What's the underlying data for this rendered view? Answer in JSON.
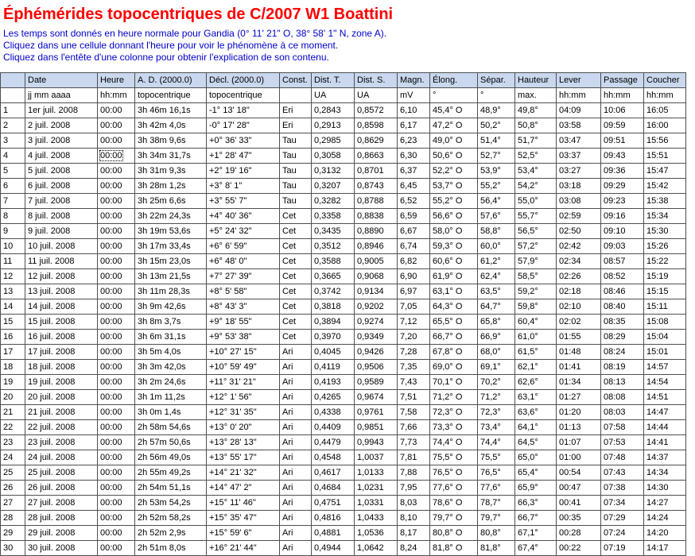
{
  "title": "Éphémérides topocentriques de C/2007 W1 Boattini",
  "intro": [
    "Les temps sont donnés en heure normale pour Gandia (0° 11' 21\" O, 38° 58' 1\" N, zone A).",
    "Cliquez dans une cellule donnant l'heure pour voir le phénomène à ce moment.",
    "Cliquez dans l'entête d'une colonne pour obtenir l'explication de son contenu."
  ],
  "columns": [
    {
      "label": "",
      "unit": ""
    },
    {
      "label": "Date",
      "unit": "jj  mm  aaaa"
    },
    {
      "label": "Heure",
      "unit": "hh:mm"
    },
    {
      "label": "A. D. (2000.0)",
      "unit": "topocentrique"
    },
    {
      "label": "Décl. (2000.0)",
      "unit": "topocentrique"
    },
    {
      "label": "Const.",
      "unit": ""
    },
    {
      "label": "Dist. T.",
      "unit": "UA"
    },
    {
      "label": "Dist. S.",
      "unit": "UA"
    },
    {
      "label": "Magn.",
      "unit": "mV"
    },
    {
      "label": "Élong.",
      "unit": "°"
    },
    {
      "label": "Sépar.",
      "unit": "°"
    },
    {
      "label": "Hauteur",
      "unit": "max."
    },
    {
      "label": "Lever",
      "unit": "hh:mm"
    },
    {
      "label": "Passage",
      "unit": "hh:mm"
    },
    {
      "label": "Coucher",
      "unit": "hh:mm"
    }
  ],
  "selected_cell": {
    "row": 3,
    "col": 2
  },
  "rows": [
    [
      "1",
      "1er juil. 2008",
      "00:00",
      "3h 46m 16,1s",
      "-1° 13' 18\"",
      "Eri",
      "0,2843",
      "0,8572",
      "6,10",
      "45,4° O",
      "48,9°",
      "49,8°",
      "04:09",
      "10:06",
      "16:05"
    ],
    [
      "2",
      "2 juil. 2008",
      "00:00",
      "3h 42m 4,0s",
      "-0° 17' 28\"",
      "Eri",
      "0,2913",
      "0,8598",
      "6,17",
      "47,2° O",
      "50,2°",
      "50,8°",
      "03:58",
      "09:59",
      "16:00"
    ],
    [
      "3",
      "3 juil. 2008",
      "00:00",
      "3h 38m 9,6s",
      "+0° 36' 33\"",
      "Tau",
      "0,2985",
      "0,8629",
      "6,23",
      "49,0° O",
      "51,4°",
      "51,7°",
      "03:47",
      "09:51",
      "15:56"
    ],
    [
      "4",
      "4 juil. 2008",
      "00:00",
      "3h 34m 31,7s",
      "+1° 28' 47\"",
      "Tau",
      "0,3058",
      "0,8663",
      "6,30",
      "50,6° O",
      "52,7°",
      "52,5°",
      "03:37",
      "09:43",
      "15:51"
    ],
    [
      "5",
      "5 juil. 2008",
      "00:00",
      "3h 31m 9,3s",
      "+2° 19' 16\"",
      "Tau",
      "0,3132",
      "0,8701",
      "6,37",
      "52,2° O",
      "53,9°",
      "53,4°",
      "03:27",
      "09:36",
      "15:47"
    ],
    [
      "6",
      "6 juil. 2008",
      "00:00",
      "3h 28m 1,2s",
      "+3° 8' 1\"",
      "Tau",
      "0,3207",
      "0,8743",
      "6,45",
      "53,7° O",
      "55,2°",
      "54,2°",
      "03:18",
      "09:29",
      "15:42"
    ],
    [
      "7",
      "7 juil. 2008",
      "00:00",
      "3h 25m 6,6s",
      "+3° 55' 7\"",
      "Tau",
      "0,3282",
      "0,8788",
      "6,52",
      "55,2° O",
      "56,4°",
      "55,0°",
      "03:08",
      "09:23",
      "15:38"
    ],
    [
      "8",
      "8 juil. 2008",
      "00:00",
      "3h 22m 24,3s",
      "+4° 40' 36\"",
      "Cet",
      "0,3358",
      "0,8838",
      "6,59",
      "56,6° O",
      "57,6°",
      "55,7°",
      "02:59",
      "09:16",
      "15:34"
    ],
    [
      "9",
      "9 juil. 2008",
      "00:00",
      "3h 19m 53,6s",
      "+5° 24' 32\"",
      "Cet",
      "0,3435",
      "0,8890",
      "6,67",
      "58,0° O",
      "58,8°",
      "56,5°",
      "02:50",
      "09:10",
      "15:30"
    ],
    [
      "10",
      "10 juil. 2008",
      "00:00",
      "3h 17m 33,4s",
      "+6° 6' 59\"",
      "Cet",
      "0,3512",
      "0,8946",
      "6,74",
      "59,3° O",
      "60,0°",
      "57,2°",
      "02:42",
      "09:03",
      "15:26"
    ],
    [
      "11",
      "11 juil. 2008",
      "00:00",
      "3h 15m 23,0s",
      "+6° 48' 0\"",
      "Cet",
      "0,3588",
      "0,9005",
      "6,82",
      "60,6° O",
      "61,2°",
      "57,9°",
      "02:34",
      "08:57",
      "15:22"
    ],
    [
      "12",
      "12 juil. 2008",
      "00:00",
      "3h 13m 21,5s",
      "+7° 27' 39\"",
      "Cet",
      "0,3665",
      "0,9068",
      "6,90",
      "61,9° O",
      "62,4°",
      "58,5°",
      "02:26",
      "08:52",
      "15:19"
    ],
    [
      "13",
      "13 juil. 2008",
      "00:00",
      "3h 11m 28,3s",
      "+8° 5' 58\"",
      "Cet",
      "0,3742",
      "0,9134",
      "6,97",
      "63,1° O",
      "63,5°",
      "59,2°",
      "02:18",
      "08:46",
      "15:15"
    ],
    [
      "14",
      "14 juil. 2008",
      "00:00",
      "3h 9m 42,6s",
      "+8° 43' 3\"",
      "Cet",
      "0,3818",
      "0,9202",
      "7,05",
      "64,3° O",
      "64,7°",
      "59,8°",
      "02:10",
      "08:40",
      "15:11"
    ],
    [
      "15",
      "15 juil. 2008",
      "00:00",
      "3h 8m 3,7s",
      "+9° 18' 55\"",
      "Cet",
      "0,3894",
      "0,9274",
      "7,12",
      "65,5° O",
      "65,8°",
      "60,4°",
      "02:02",
      "08:35",
      "15:08"
    ],
    [
      "16",
      "16 juil. 2008",
      "00:00",
      "3h 6m 31,1s",
      "+9° 53' 38\"",
      "Cet",
      "0,3970",
      "0,9349",
      "7,20",
      "66,7° O",
      "66,9°",
      "61,0°",
      "01:55",
      "08:29",
      "15:04"
    ],
    [
      "17",
      "17 juil. 2008",
      "00:00",
      "3h 5m 4,0s",
      "+10° 27' 15\"",
      "Ari",
      "0,4045",
      "0,9426",
      "7,28",
      "67,8° O",
      "68,0°",
      "61,5°",
      "01:48",
      "08:24",
      "15:01"
    ],
    [
      "18",
      "18 juil. 2008",
      "00:00",
      "3h 3m 42,0s",
      "+10° 59' 49\"",
      "Ari",
      "0,4119",
      "0,9506",
      "7,35",
      "69,0° O",
      "69,1°",
      "62,1°",
      "01:41",
      "08:19",
      "14:57"
    ],
    [
      "19",
      "19 juil. 2008",
      "00:00",
      "3h 2m 24,6s",
      "+11° 31' 21\"",
      "Ari",
      "0,4193",
      "0,9589",
      "7,43",
      "70,1° O",
      "70,2°",
      "62,6°",
      "01:34",
      "08:13",
      "14:54"
    ],
    [
      "20",
      "20 juil. 2008",
      "00:00",
      "3h 1m 11,2s",
      "+12° 1' 56\"",
      "Ari",
      "0,4265",
      "0,9674",
      "7,51",
      "71,2° O",
      "71,2°",
      "63,1°",
      "01:27",
      "08:08",
      "14:51"
    ],
    [
      "21",
      "21 juil. 2008",
      "00:00",
      "3h 0m 1,4s",
      "+12° 31' 35\"",
      "Ari",
      "0,4338",
      "0,9761",
      "7,58",
      "72,3° O",
      "72,3°",
      "63,6°",
      "01:20",
      "08:03",
      "14:47"
    ],
    [
      "22",
      "22 juil. 2008",
      "00:00",
      "2h 58m 54,6s",
      "+13° 0' 20\"",
      "Ari",
      "0,4409",
      "0,9851",
      "7,66",
      "73,3° O",
      "73,4°",
      "64,1°",
      "01:13",
      "07:58",
      "14:44"
    ],
    [
      "23",
      "23 juil. 2008",
      "00:00",
      "2h 57m 50,6s",
      "+13° 28' 13\"",
      "Ari",
      "0,4479",
      "0,9943",
      "7,73",
      "74,4° O",
      "74,4°",
      "64,5°",
      "01:07",
      "07:53",
      "14:41"
    ],
    [
      "24",
      "24 juil. 2008",
      "00:00",
      "2h 56m 49,0s",
      "+13° 55' 17\"",
      "Ari",
      "0,4548",
      "1,0037",
      "7,81",
      "75,5° O",
      "75,5°",
      "65,0°",
      "01:00",
      "07:48",
      "14:37"
    ],
    [
      "25",
      "25 juil. 2008",
      "00:00",
      "2h 55m 49,2s",
      "+14° 21' 32\"",
      "Ari",
      "0,4617",
      "1,0133",
      "7,88",
      "76,5° O",
      "76,5°",
      "65,4°",
      "00:54",
      "07:43",
      "14:34"
    ],
    [
      "26",
      "26 juil. 2008",
      "00:00",
      "2h 54m 51,1s",
      "+14° 47' 2\"",
      "Ari",
      "0,4684",
      "1,0231",
      "7,95",
      "77,6° O",
      "77,6°",
      "65,9°",
      "00:47",
      "07:38",
      "14:30"
    ],
    [
      "27",
      "27 juil. 2008",
      "00:00",
      "2h 53m 54,2s",
      "+15° 11' 46\"",
      "Ari",
      "0,4751",
      "1,0331",
      "8,03",
      "78,6° O",
      "78,7°",
      "66,3°",
      "00:41",
      "07:34",
      "14:27"
    ],
    [
      "28",
      "28 juil. 2008",
      "00:00",
      "2h 52m 58,2s",
      "+15° 35' 47\"",
      "Ari",
      "0,4816",
      "1,0433",
      "8,10",
      "79,7° O",
      "79,7°",
      "66,7°",
      "00:35",
      "07:29",
      "14:24"
    ],
    [
      "29",
      "29 juil. 2008",
      "00:00",
      "2h 52m 2,9s",
      "+15° 59' 6\"",
      "Ari",
      "0,4881",
      "1,0536",
      "8,17",
      "80,8° O",
      "80,8°",
      "67,1°",
      "00:28",
      "07:24",
      "14:20"
    ],
    [
      "30",
      "30 juil. 2008",
      "00:00",
      "2h 51m 8,0s",
      "+16° 21' 44\"",
      "Ari",
      "0,4944",
      "1,0642",
      "8,24",
      "81,8° O",
      "81,8°",
      "67,4°",
      "00:22",
      "07:19",
      "14:17"
    ]
  ]
}
